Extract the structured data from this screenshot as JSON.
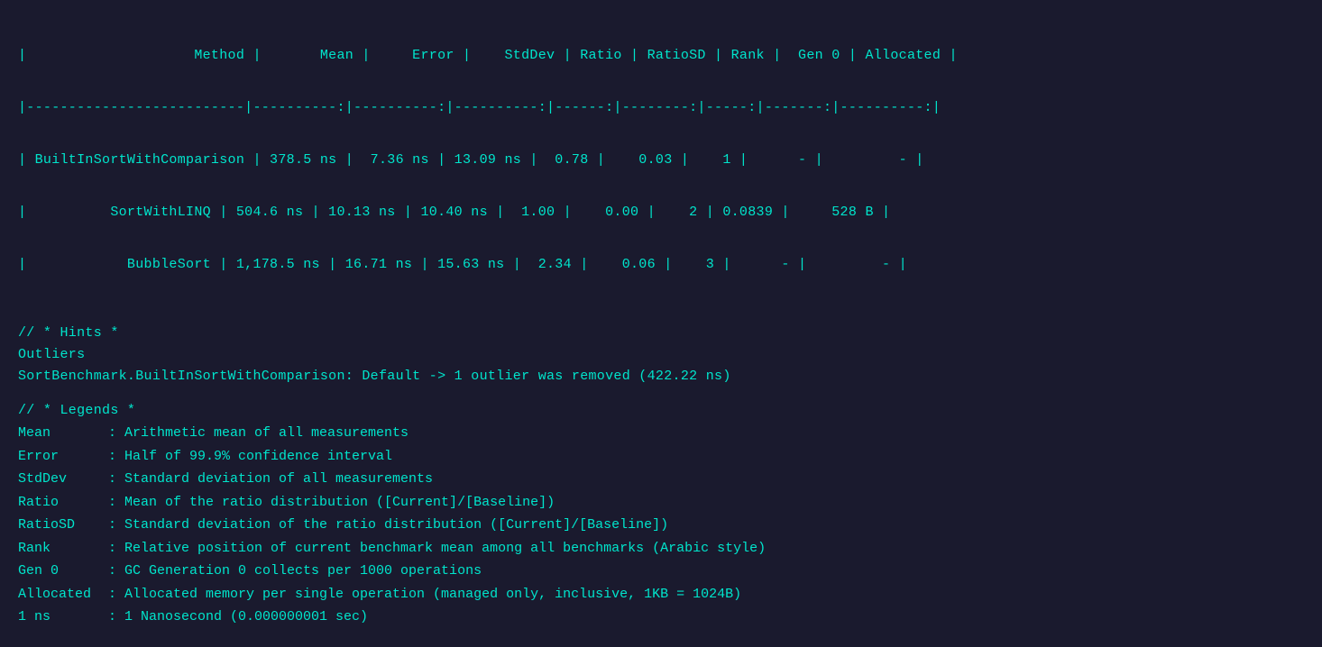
{
  "table": {
    "header_line": "|                    Method |       Mean |     Error |    StdDev | Ratio | RatioSD | Rank |  Gen 0 | Allocated |",
    "separator_line": "|--------------------------|----------:|----------:|----------:|------:|--------:|-----:|-------:|----------:|",
    "rows": [
      "| BuiltInSortWithComparison | 378.5 ns |  7.36 ns | 13.09 ns |  0.78 |    0.03 |    1 |      - |         - |",
      "|          SortWithLINQ | 504.6 ns | 10.13 ns | 10.40 ns |  1.00 |    0.00 |    2 | 0.0839 |     528 B |",
      "|            BubbleSort | 1,178.5 ns | 16.71 ns | 15.63 ns |  2.34 |    0.06 |    3 |      - |         - |"
    ]
  },
  "hints": {
    "comment": "// * Hints *",
    "outliers_label": "Outliers",
    "outlier_line": "  SortBenchmark.BuiltInSortWithComparison: Default -> 1 outlier  was  removed (422.22 ns)"
  },
  "legends": {
    "comment": "// * Legends *",
    "items": [
      {
        "key": "Mean     ",
        "value": ": Arithmetic mean of all measurements"
      },
      {
        "key": "Error    ",
        "value": ": Half of 99.9% confidence interval"
      },
      {
        "key": "StdDev   ",
        "value": ": Standard deviation of all measurements"
      },
      {
        "key": "Ratio    ",
        "value": ": Mean of the ratio distribution ([Current]/[Baseline])"
      },
      {
        "key": "RatioSD  ",
        "value": ": Standard deviation of the ratio distribution ([Current]/[Baseline])"
      },
      {
        "key": "Rank     ",
        "value": ": Relative position of current benchmark mean among all benchmarks (Arabic style)"
      },
      {
        "key": "Gen 0    ",
        "value": ": GC Generation 0 collects per 1000 operations"
      },
      {
        "key": "Allocated",
        "value": ": Allocated memory per single operation (managed only, inclusive, 1KB = 1024B)"
      },
      {
        "key": "1 ns     ",
        "value": ": 1 Nanosecond (0.000000001 sec)"
      }
    ]
  }
}
